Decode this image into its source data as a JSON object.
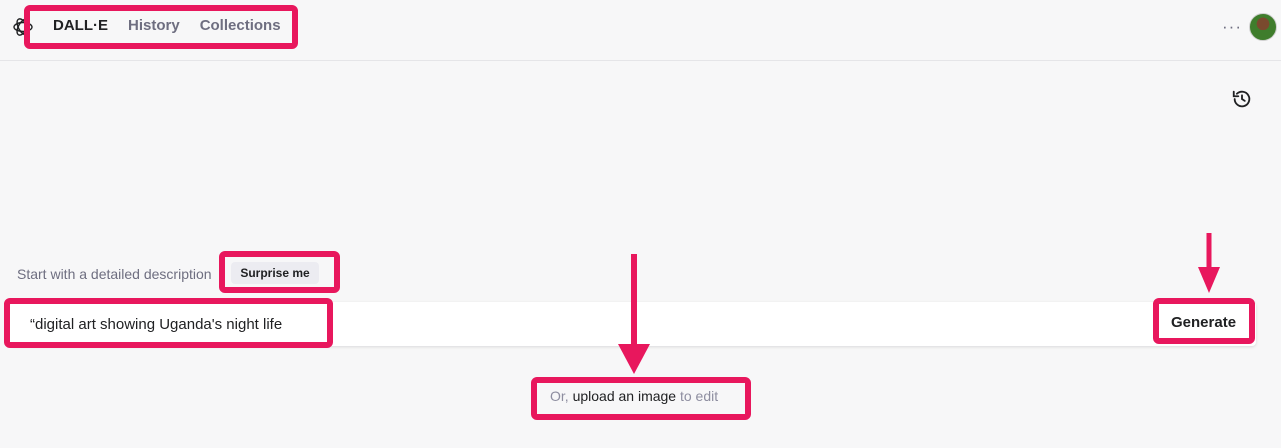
{
  "header": {
    "tabs": [
      {
        "label": "DALL·E",
        "active": true
      },
      {
        "label": "History",
        "active": false
      },
      {
        "label": "Collections",
        "active": false
      }
    ],
    "more_label": "···"
  },
  "prompt": {
    "hint": "Start with a detailed description",
    "surprise_label": "Surprise me",
    "value": "“digital art showing Uganda's night life",
    "generate_label": "Generate"
  },
  "upload": {
    "prefix": "Or, ",
    "link": "upload an image",
    "suffix": " to edit"
  },
  "colors": {
    "highlight": "#e8175d",
    "background": "#f7f7f8"
  }
}
